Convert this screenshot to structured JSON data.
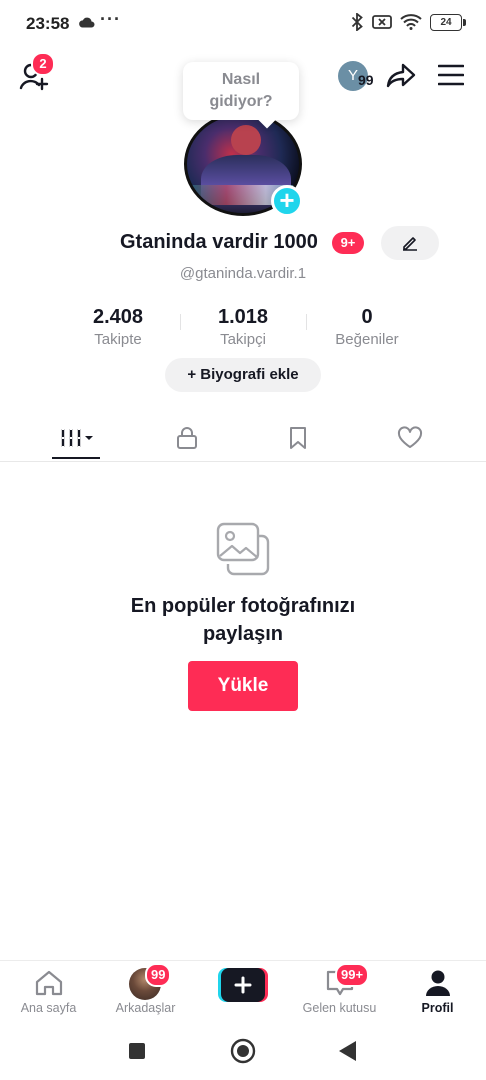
{
  "status_bar": {
    "time": "23:58",
    "dots": "···",
    "battery": "24"
  },
  "header": {
    "add_friend_badge": "2",
    "tooltip": [
      "Nasıl",
      "gidiyor?"
    ],
    "mini_avatar_letter": "Y",
    "mini_avatar_count": "99"
  },
  "profile": {
    "display_name": "Gtaninda vardir 1000",
    "name_badge": "9+",
    "handle": "@gtaninda.vardir.1",
    "stats": [
      {
        "value": "2.408",
        "label": "Takipte"
      },
      {
        "value": "1.018",
        "label": "Takipçi"
      },
      {
        "value": "0",
        "label": "Beğeniler"
      }
    ],
    "bio_button": "+ Biyografi ekle"
  },
  "empty_state": {
    "title_line1": "En popüler fotoğrafınızı",
    "title_line2": "paylaşın",
    "upload_button": "Yükle"
  },
  "bottom_nav": {
    "home": "Ana sayfa",
    "friends": "Arkadaşlar",
    "friends_badge": "99",
    "inbox": "Gelen kutusu",
    "inbox_badge": "99+",
    "profile": "Profil"
  },
  "colors": {
    "accent": "#fe2c55",
    "cyan": "#20d5ec",
    "text": "#161823",
    "muted": "#8a8b91"
  }
}
